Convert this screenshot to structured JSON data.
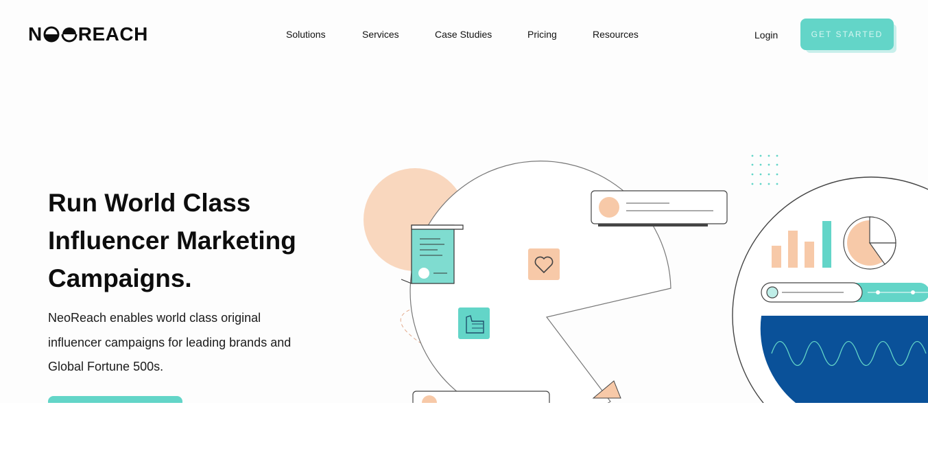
{
  "brand": {
    "name": "NEOREACH",
    "logo_left": "N",
    "logo_right": "REACH"
  },
  "nav": {
    "items": [
      {
        "label": "Solutions"
      },
      {
        "label": "Services"
      },
      {
        "label": "Case Studies"
      },
      {
        "label": "Pricing"
      },
      {
        "label": "Resources"
      }
    ],
    "login_label": "Login",
    "cta_label": "GET STARTED"
  },
  "hero": {
    "title": "Run World Class Influencer Marketing Campaigns.",
    "description": "NeoReach enables world class original influencer campaigns for leading brands and Global Fortune 500s.",
    "cta_label": ""
  },
  "colors": {
    "accent": "#63d5c8",
    "peach": "#f7c9a8",
    "navy": "#0a5199",
    "text": "#0d0d0d"
  },
  "icons": [
    "contract-icon",
    "heart-icon",
    "thumbs-up-icon",
    "search-icon",
    "bar-chart-icon",
    "pie-chart-icon"
  ]
}
